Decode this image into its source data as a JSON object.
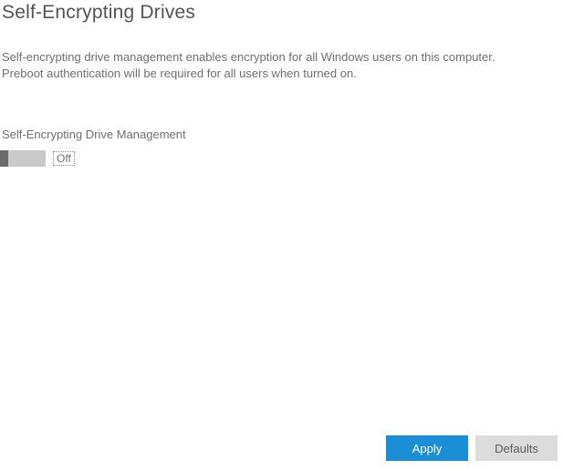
{
  "title": "Self-Encrypting Drives",
  "description_line1": "Self-encrypting drive management enables encryption for all Windows users on this computer.",
  "description_line2": "Preboot authentication will be required for all users when turned on.",
  "section_label": "Self-Encrypting Drive Management",
  "toggle_state": "Off",
  "buttons": {
    "apply": "Apply",
    "defaults": "Defaults"
  }
}
